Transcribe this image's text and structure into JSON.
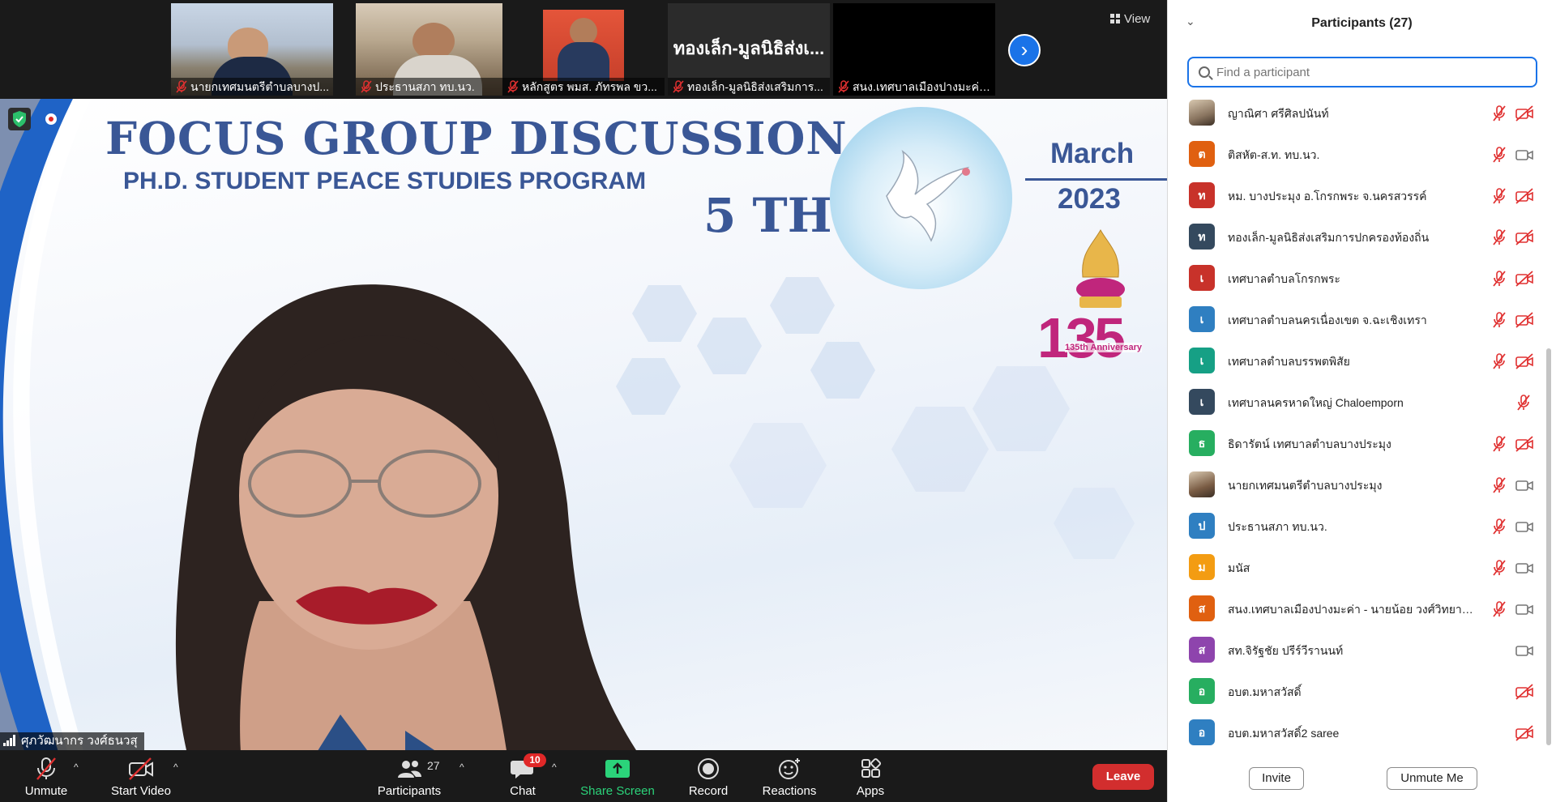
{
  "thumbnails": [
    {
      "name": "นายกเทศมนตรีตำบลบางป...",
      "big_name": ""
    },
    {
      "name": "ประธานสภา ทบ.นว.",
      "big_name": ""
    },
    {
      "name": "หลักสูตร พมส. ภัทรพล ขว...",
      "big_name": ""
    },
    {
      "name": "ทองเล็ก-มูลนิธิส่งเสริมการ...",
      "big_name": "ทองเล็ก-มูลนิธิส่งเ..."
    },
    {
      "name": "สนง.เทศบาลเมืองปางมะค่า ...",
      "big_name": ""
    }
  ],
  "view_label": "View",
  "slide": {
    "title": "FOCUS GROUP DISCUSSION",
    "subtitle": "PH.D. STUDENT PEACE STUDIES PROGRAM",
    "edition": "5 TH",
    "month": "March",
    "year": "2023",
    "anniversary_number": "135",
    "anniversary_text": "135th Anniversary"
  },
  "speaker_name": "ศุภวัฒนากร วงศ์ธนวสุ",
  "toolbar": {
    "unmute": "Unmute",
    "start_video": "Start Video",
    "participants": "Participants",
    "participants_count": "27",
    "chat": "Chat",
    "chat_badge": "10",
    "share_screen": "Share Screen",
    "record": "Record",
    "reactions": "Reactions",
    "apps": "Apps",
    "leave": "Leave"
  },
  "panel": {
    "title": "Participants (27)",
    "search_placeholder": "Find a participant",
    "invite": "Invite",
    "unmute_me": "Unmute Me"
  },
  "participants": [
    {
      "initial": "",
      "name": "ญาณิศา ศรีศิลปนันท์",
      "color": "#8a7560",
      "photo": true,
      "mic": "off",
      "cam": "off"
    },
    {
      "initial": "ต",
      "name": "ติสหัต-ส.ท. ทบ.นว.",
      "color": "#e06010",
      "photo": false,
      "mic": "off",
      "cam": "on"
    },
    {
      "initial": "ท",
      "name": "หม. บางประมุง อ.โกรกพระ จ.นครสวรรค์",
      "color": "#c8322a",
      "photo": false,
      "mic": "off",
      "cam": "off"
    },
    {
      "initial": "ท",
      "name": "ทองเล็ก-มูลนิธิส่งเสริมการปกครองท้องถิ่น",
      "color": "#34495e",
      "photo": false,
      "mic": "off",
      "cam": "off"
    },
    {
      "initial": "เ",
      "name": "เทศบาลตำบลโกรกพระ",
      "color": "#c8322a",
      "photo": false,
      "mic": "off",
      "cam": "off"
    },
    {
      "initial": "เ",
      "name": "เทศบาลตำบลนครเนื่องเขต จ.ฉะเชิงเทรา",
      "color": "#2f7fc1",
      "photo": false,
      "mic": "off",
      "cam": "off"
    },
    {
      "initial": "เ",
      "name": "เทศบาลตำบลบรรพตพิสัย",
      "color": "#16a085",
      "photo": false,
      "mic": "off",
      "cam": "off"
    },
    {
      "initial": "เ",
      "name": "เทศบาลนครหาดใหญ่ Chaloemporn",
      "color": "#34495e",
      "photo": false,
      "mic": "off",
      "cam": "none"
    },
    {
      "initial": "ธ",
      "name": "ธิดารัตน์  เทศบาลตำบลบางประมุง",
      "color": "#27ae60",
      "photo": false,
      "mic": "off",
      "cam": "off"
    },
    {
      "initial": "",
      "name": "นายกเทศมนตรีตำบลบางประมุง",
      "color": "#7a5c44",
      "photo": true,
      "mic": "off",
      "cam": "on"
    },
    {
      "initial": "ป",
      "name": "ประธานสภา ทบ.นว.",
      "color": "#2f7fc1",
      "photo": false,
      "mic": "off",
      "cam": "on"
    },
    {
      "initial": "ม",
      "name": "มนัส",
      "color": "#f39c12",
      "photo": false,
      "mic": "off",
      "cam": "on"
    },
    {
      "initial": "ส",
      "name": "สนง.เทศบาลเมืองปางมะค่า - นายน้อย วงศ์วิทยานันท์...",
      "color": "#e06010",
      "photo": false,
      "mic": "off",
      "cam": "on"
    },
    {
      "initial": "ส",
      "name": "สท.จิรัฐชัย ปรีร์วีรานนท์",
      "color": "#8e44ad",
      "photo": false,
      "mic": "none",
      "cam": "on"
    },
    {
      "initial": "อ",
      "name": "อบต.มหาสวัสดิ์",
      "color": "#27ae60",
      "photo": false,
      "mic": "none",
      "cam": "off"
    },
    {
      "initial": "อ",
      "name": "อบต.มหาสวัสดิ์2 saree",
      "color": "#2f7fc1",
      "photo": false,
      "mic": "none",
      "cam": "off"
    }
  ]
}
